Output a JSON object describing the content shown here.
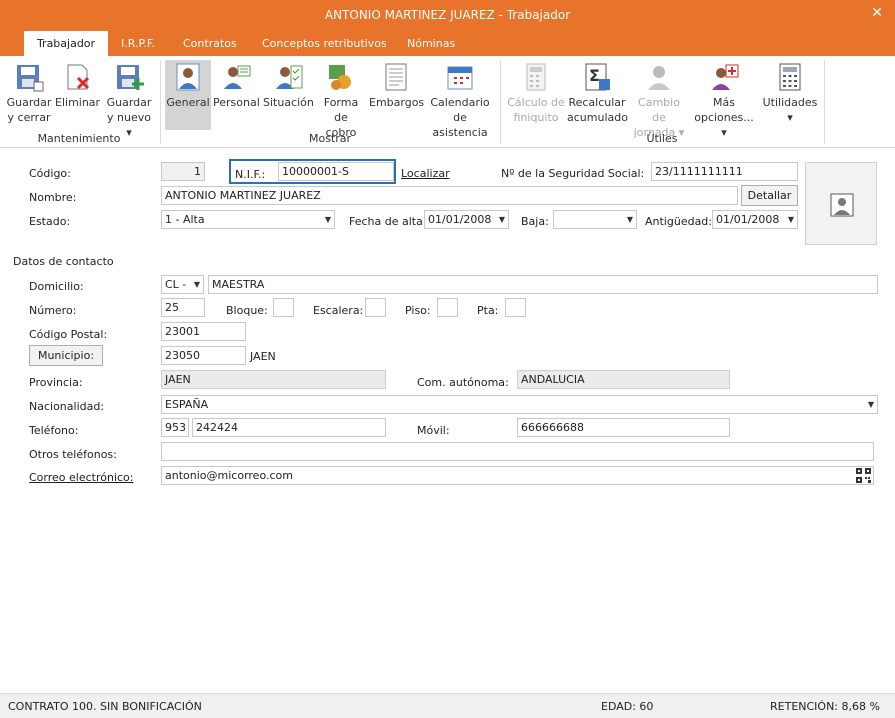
{
  "window": {
    "title": "ANTONIO MARTINEZ JUAREZ - Trabajador"
  },
  "tabs": [
    "Trabajador",
    "I.R.P.F.",
    "Contratos",
    "Conceptos retributivos",
    "Nóminas"
  ],
  "ribbon": {
    "mantenimiento": {
      "label": "Mantenimiento",
      "guardar_cerrar": [
        "Guardar",
        "y cerrar"
      ],
      "eliminar": "Eliminar",
      "guardar_nuevo": [
        "Guardar",
        "y nuevo"
      ]
    },
    "mostrar": {
      "label": "Mostrar",
      "general": "General",
      "personal": "Personal",
      "situacion": "Situación",
      "forma_cobro": [
        "Forma",
        "de cobro"
      ],
      "embargos": "Embargos",
      "calendario": [
        "Calendario",
        "de asistencia"
      ]
    },
    "utiles": {
      "label": "Útiles",
      "calculo": [
        "Cálculo de",
        "finiquito"
      ],
      "recalcular": [
        "Recalcular",
        "acumulado"
      ],
      "cambio": [
        "Cambio de",
        "jornada"
      ],
      "mas": [
        "Más",
        "opciones..."
      ],
      "utilidades": "Utilidades"
    }
  },
  "form": {
    "codigo_label": "Código:",
    "codigo_value": "1",
    "nif_label": "N.I.F.:",
    "nif_value": "10000001-S",
    "localizar": "Localizar",
    "nss_label": "Nº de la Seguridad Social:",
    "nss_value": "23/1111111111",
    "nombre_label": "Nombre:",
    "nombre_value": "ANTONIO MARTINEZ JUAREZ",
    "detallar": "Detallar",
    "estado_label": "Estado:",
    "estado_value": "1 - Alta",
    "fecha_alta_label": "Fecha de alta:",
    "fecha_alta_value": "01/01/2008",
    "baja_label": "Baja:",
    "baja_value": "",
    "antiguedad_label": "Antigüedad:",
    "antiguedad_value": "01/01/2008",
    "contacto_heading": "Datos de contacto",
    "domicilio_label": "Domicilio:",
    "via_value": "CL -",
    "domicilio_value": "MAESTRA",
    "numero_label": "Número:",
    "numero_value": "25",
    "bloque_label": "Bloque:",
    "escalera_label": "Escalera:",
    "piso_label": "Piso:",
    "pta_label": "Pta:",
    "cp_label": "Código Postal:",
    "cp_value": "23001",
    "municipio_label": "Municipio:",
    "municipio_code": "23050",
    "municipio_name": "JAEN",
    "provincia_label": "Provincia:",
    "provincia_value": "JAEN",
    "ccaa_label": "Com. autónoma:",
    "ccaa_value": "ANDALUCIA",
    "nacionalidad_label": "Nacionalidad:",
    "nacionalidad_value": "ESPAÑA",
    "telefono_label": "Teléfono:",
    "telefono_prefijo": "953",
    "telefono_numero": "242424",
    "movil_label": "Móvil:",
    "movil_value": "666666688",
    "otros_label": "Otros teléfonos:",
    "otros_value": "",
    "correo_label": "Correo electrónico:",
    "correo_value": "antonio@micorreo.com"
  },
  "status": {
    "contrato": "CONTRATO 100.  SIN BONIFICACIÓN",
    "edad": "EDAD: 60",
    "retencion": "RETENCIÓN: 8,68 %"
  },
  "colors": {
    "accent": "#e8732a",
    "focus": "#2a6fb7"
  }
}
